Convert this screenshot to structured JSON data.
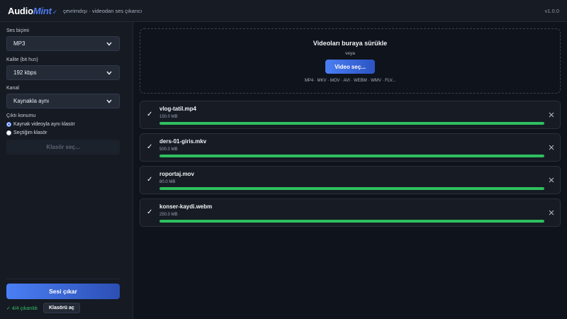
{
  "app": {
    "logo_part1": "Audio",
    "logo_part2": "Mint",
    "logo_mark": "✓",
    "subtitle": "çevrimdışı · videodan ses çıkarıcı",
    "version": "v1.0.0"
  },
  "sidebar": {
    "format_label": "Ses biçimi",
    "format_value": "MP3",
    "quality_label": "Kalite (bit hızı)",
    "quality_value": "192 kbps",
    "channel_label": "Kanal",
    "channel_value": "Kaynakla aynı",
    "output_label": "Çıktı konumu",
    "output_option_source": "Kaynak videoyla aynı klasör",
    "output_option_custom": "Seçtiğim klasör",
    "output_selected": "source",
    "folder_button": "Klasör seç...",
    "extract_button": "Sesi çıkar",
    "status_text": "✓ 4/4 çıkarıldı",
    "open_folder_button": "Klasörü aç"
  },
  "dropzone": {
    "title": "Videoları buraya sürükle",
    "or_text": "veya",
    "choose_button": "Video seç...",
    "formats": "MP4 · MKV · MOV · AVI · WEBM · WMV · FLV..."
  },
  "files": [
    {
      "name": "vlog-tatil.mp4",
      "size": "150.0 MB",
      "progress": 100,
      "status_icon": "check-icon"
    },
    {
      "name": "ders-01-giris.mkv",
      "size": "500.0 MB",
      "progress": 100,
      "status_icon": "check-icon"
    },
    {
      "name": "roportaj.mov",
      "size": "80.0 MB",
      "progress": 100,
      "status_icon": "check-icon"
    },
    {
      "name": "konser-kaydi.webm",
      "size": "250.0 MB",
      "progress": 100,
      "status_icon": "check-icon"
    }
  ],
  "colors": {
    "accent": "#4a7ff4",
    "success": "#2fbf5f",
    "background": "#0f131b"
  }
}
